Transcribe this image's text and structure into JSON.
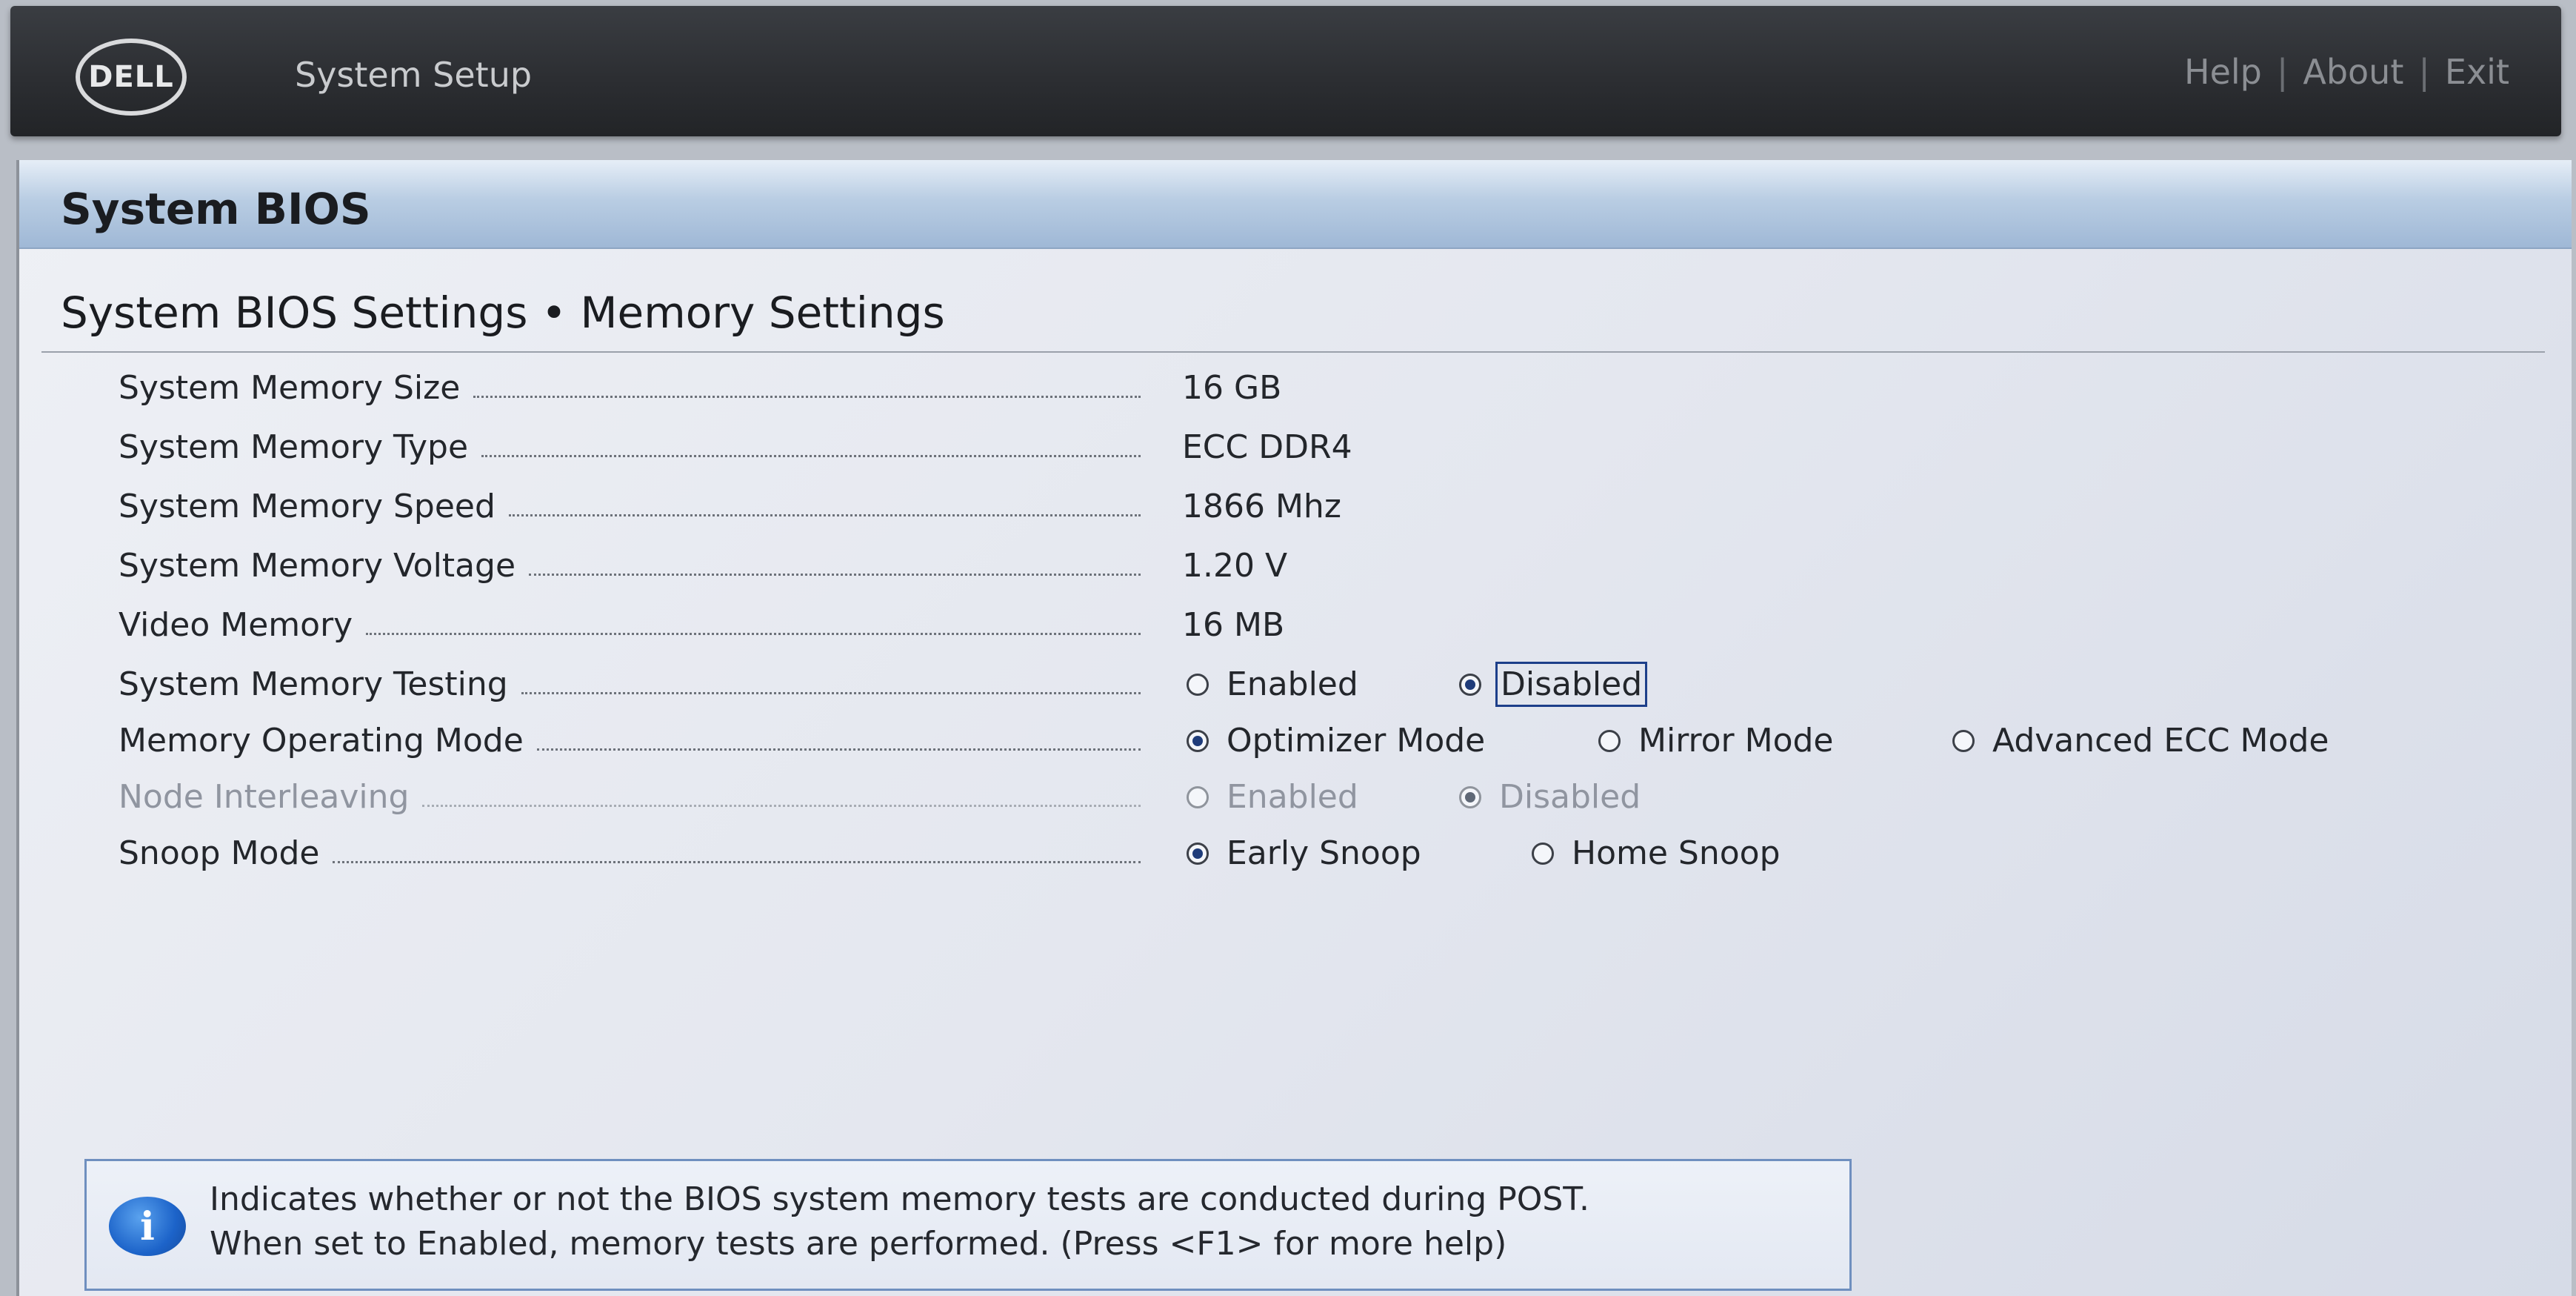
{
  "header": {
    "logo_text": "DELL",
    "app_title": "System Setup",
    "nav": {
      "help": "Help",
      "about": "About",
      "exit": "Exit",
      "separator": "|"
    }
  },
  "panel": {
    "title": "System BIOS",
    "page_title": "System BIOS Settings • Memory Settings"
  },
  "settings": [
    {
      "label": "System Memory Size",
      "value": "16 GB"
    },
    {
      "label": "System Memory Type",
      "value": "ECC DDR4"
    },
    {
      "label": "System Memory Speed",
      "value": "1866 Mhz"
    },
    {
      "label": "System Memory Voltage",
      "value": "1.20 V"
    },
    {
      "label": "Video Memory",
      "value": "16 MB"
    },
    {
      "label": "System Memory Testing",
      "options": [
        "Enabled",
        "Disabled"
      ],
      "selected": "Disabled"
    },
    {
      "label": "Memory Operating Mode",
      "options": [
        "Optimizer Mode",
        "Mirror Mode",
        "Advanced ECC Mode"
      ],
      "selected": "Optimizer Mode"
    },
    {
      "label": "Node Interleaving",
      "options": [
        "Enabled",
        "Disabled"
      ],
      "selected": "Disabled",
      "disabled": true
    },
    {
      "label": "Snoop Mode",
      "options": [
        "Early Snoop",
        "Home Snoop"
      ],
      "selected": "Early Snoop"
    }
  ],
  "help": {
    "icon": "info-icon",
    "glyph": "i",
    "line1": "Indicates whether or not the BIOS system memory tests are conducted during POST.",
    "line2": "When set to Enabled, memory tests are performed. (Press <F1> for more help)"
  },
  "colors": {
    "topbar": "#2b2d31",
    "header_blue": "#9fb8d6",
    "accent": "#1f3c7a"
  }
}
